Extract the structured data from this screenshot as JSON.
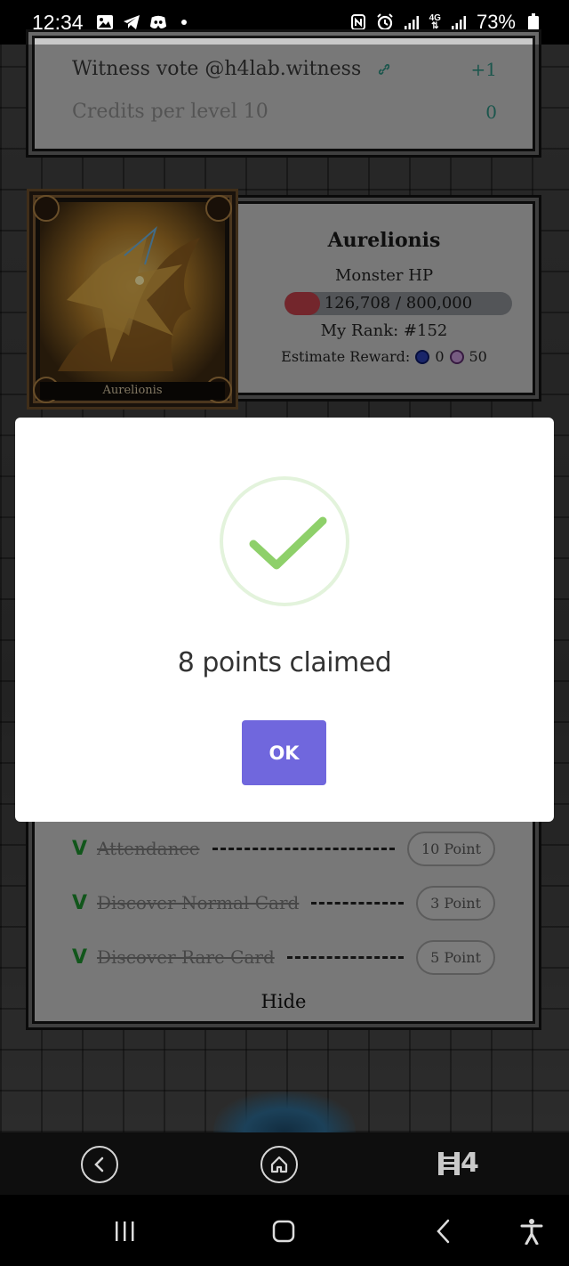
{
  "status_bar": {
    "time": "12:34",
    "battery_text": "73%",
    "network_label": "4G",
    "icons": [
      "gallery-icon",
      "telegram-icon",
      "discord-icon",
      "notification-dot",
      "nfc-icon",
      "alarm-icon",
      "signal-icon",
      "signal-icon",
      "battery-icon"
    ]
  },
  "witness_panel": {
    "vote_label": "Witness vote @h4lab.witness",
    "vote_value": "+1",
    "credits_label": "Credits per level 10",
    "credits_value": "0"
  },
  "monster": {
    "card_name": "Aurelionis",
    "name": "Aurelionis",
    "hp_label": "Monster HP",
    "hp_text": "126,708 / 800,000",
    "hp_fraction": 0.158,
    "rank_text": "My Rank: #152",
    "reward_label": "Estimate Reward:",
    "reward_steem": "0",
    "reward_token": "50"
  },
  "quests": {
    "items": [
      {
        "check": "V",
        "name": "Attendance",
        "points": "10 Point"
      },
      {
        "check": "V",
        "name": "Discover Normal Card",
        "points": "3 Point"
      },
      {
        "check": "V",
        "name": "Discover Rare Card",
        "points": "5 Point"
      }
    ],
    "hide_label": "Hide"
  },
  "modal": {
    "title": "8 points claimed",
    "ok_label": "OK",
    "icon": "success-check-icon"
  },
  "app_nav": {
    "logo_text": "4",
    "icons": [
      "back-circle-icon",
      "home-circle-icon",
      "h4-logo"
    ]
  },
  "system_nav": {
    "icons": [
      "recents-icon",
      "home-icon",
      "back-icon",
      "accessibility-icon"
    ]
  },
  "colors": {
    "accent": "#7067dd",
    "success": "#8ed06a",
    "hp_bar": "#c0404a",
    "teal": "#2f8f80"
  }
}
